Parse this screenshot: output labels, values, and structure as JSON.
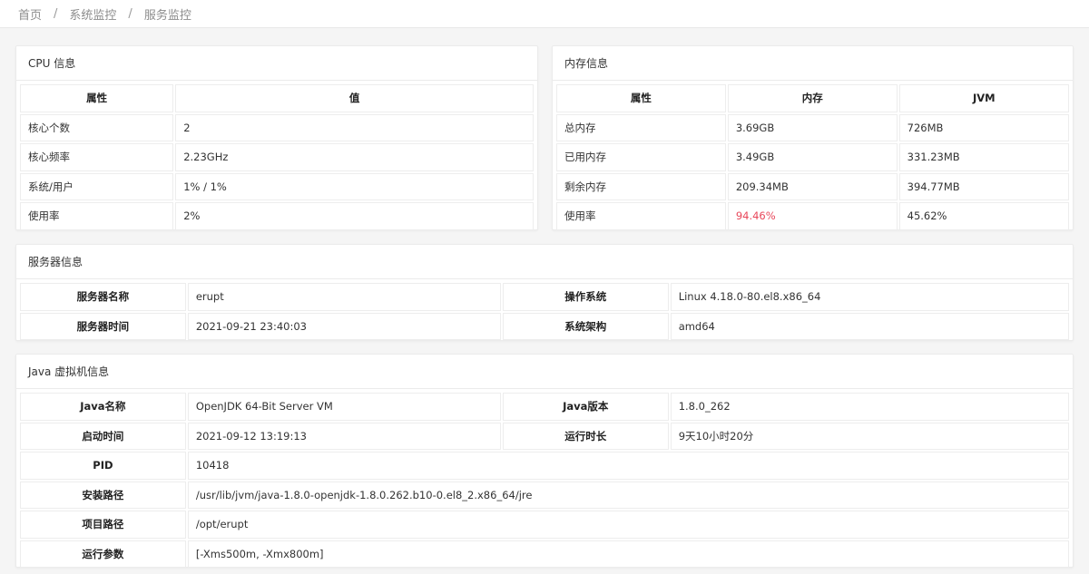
{
  "breadcrumb": {
    "home": "首页",
    "section": "系统监控",
    "current": "服务监控",
    "separator": "/"
  },
  "cpu": {
    "title": "CPU 信息",
    "headers": [
      "属性",
      "值"
    ],
    "rows": [
      [
        "核心个数",
        "2"
      ],
      [
        "核心频率",
        "2.23GHz"
      ],
      [
        "系统/用户",
        "1% / 1%"
      ],
      [
        "使用率",
        "2%"
      ]
    ]
  },
  "memory": {
    "title": "内存信息",
    "headers": [
      "属性",
      "内存",
      "JVM"
    ],
    "rows": [
      [
        "总内存",
        "3.69GB",
        "726MB"
      ],
      [
        "已用内存",
        "3.49GB",
        "331.23MB"
      ],
      [
        "剩余内存",
        "209.34MB",
        "394.77MB"
      ],
      [
        "使用率",
        "94.46%",
        "45.62%"
      ]
    ],
    "danger_color": "#e8475a"
  },
  "server": {
    "title": "服务器信息",
    "rows": [
      [
        "服务器名称",
        "erupt",
        "操作系统",
        "Linux 4.18.0-80.el8.x86_64"
      ],
      [
        "服务器时间",
        "2021-09-21 23:40:03",
        "系统架构",
        "amd64"
      ]
    ]
  },
  "jvm": {
    "title": "Java 虚拟机信息",
    "rows": [
      [
        "Java名称",
        "OpenJDK 64-Bit Server VM",
        "Java版本",
        "1.8.0_262"
      ],
      [
        "启动时间",
        "2021-09-12 13:19:13",
        "运行时长",
        "9天10小时20分"
      ]
    ],
    "wide_rows": [
      [
        "PID",
        "10418"
      ],
      [
        "安装路径",
        "/usr/lib/jvm/java-1.8.0-openjdk-1.8.0.262.b10-0.el8_2.x86_64/jre"
      ],
      [
        "项目路径",
        "/opt/erupt"
      ],
      [
        "运行参数",
        "[-Xms500m, -Xmx800m]"
      ]
    ]
  }
}
